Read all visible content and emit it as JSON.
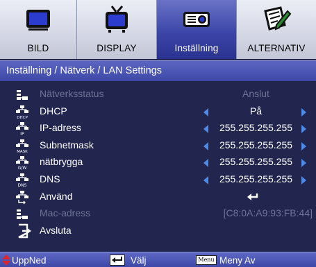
{
  "tabs": [
    {
      "label": "BILD",
      "icon": "monitor-icon",
      "active": false
    },
    {
      "label": "DISPLAY",
      "icon": "tv-icon",
      "active": false
    },
    {
      "label": "Inställning",
      "icon": "projector-icon",
      "active": true
    },
    {
      "label": "ALTERNATIV",
      "icon": "options-icon",
      "active": false
    }
  ],
  "header": {
    "title": "Inställning / Nätverk / LAN Settings"
  },
  "rows": [
    {
      "label": "Nätverksstatus",
      "value": "Anslut",
      "icon": "network-status-icon",
      "disabled": true,
      "arrows": false
    },
    {
      "label": "DHCP",
      "value": "På",
      "icon": "dhcp-icon",
      "disabled": false,
      "arrows": true
    },
    {
      "label": "IP-adress",
      "value": "255.255.255.255",
      "icon": "ip-icon",
      "disabled": false,
      "arrows": true
    },
    {
      "label": "Subnetmask",
      "value": "255.255.255.255",
      "icon": "mask-icon",
      "disabled": false,
      "arrows": true
    },
    {
      "label": "nätbrygga",
      "value": "255.255.255.255",
      "icon": "gateway-icon",
      "disabled": false,
      "arrows": true
    },
    {
      "label": "DNS",
      "value": "255.255.255.255",
      "icon": "dns-icon",
      "disabled": false,
      "arrows": true
    },
    {
      "label": "Använd",
      "value": "",
      "icon": "apply-icon",
      "disabled": false,
      "arrows": false,
      "enter": true
    },
    {
      "label": "Mac-adress",
      "value": "[C8:0A:A9:93:FB:44]",
      "icon": "mac-address-icon",
      "disabled": true,
      "arrows": false
    },
    {
      "label": "Avsluta",
      "value": "",
      "icon": "exit-icon",
      "disabled": false,
      "arrows": false
    }
  ],
  "footer": {
    "nav_label": "UppNed",
    "select_label": "Välj",
    "menu_key": "Menu",
    "menu_label": "Meny Av"
  },
  "colors": {
    "background": "#22264e",
    "active_tab": "#3c46a8",
    "header": "#4a54b4",
    "arrow": "#4e8be8",
    "nav_arrow": "#e0242a"
  }
}
